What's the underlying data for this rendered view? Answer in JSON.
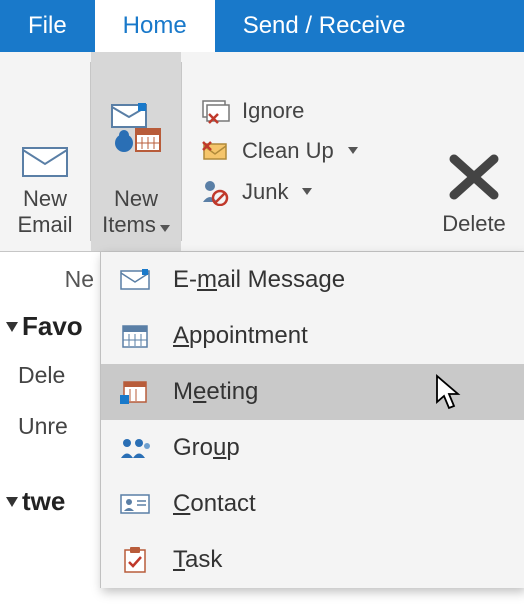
{
  "tabs": {
    "file": "File",
    "home": "Home",
    "send_receive": "Send / Receive"
  },
  "ribbon": {
    "new_email": "New\nEmail",
    "new_items": "New\nItems",
    "ignore": "Ignore",
    "clean_up": "Clean Up",
    "junk": "Junk",
    "delete": "Delete"
  },
  "nav": {
    "truncated_top": "Ne",
    "favorites": "Favo",
    "deleted": "Dele",
    "unread": "Unre",
    "account": "twe"
  },
  "menu": {
    "email": {
      "pre": "E-",
      "u": "m",
      "post": "ail Message"
    },
    "appointment": {
      "pre": "",
      "u": "A",
      "post": "ppointment"
    },
    "meeting": {
      "pre": "M",
      "u": "e",
      "post": "eting"
    },
    "group": {
      "pre": "Gro",
      "u": "u",
      "post": "p"
    },
    "contact": {
      "pre": "",
      "u": "C",
      "post": "ontact"
    },
    "task": {
      "pre": "",
      "u": "T",
      "post": "ask"
    }
  }
}
